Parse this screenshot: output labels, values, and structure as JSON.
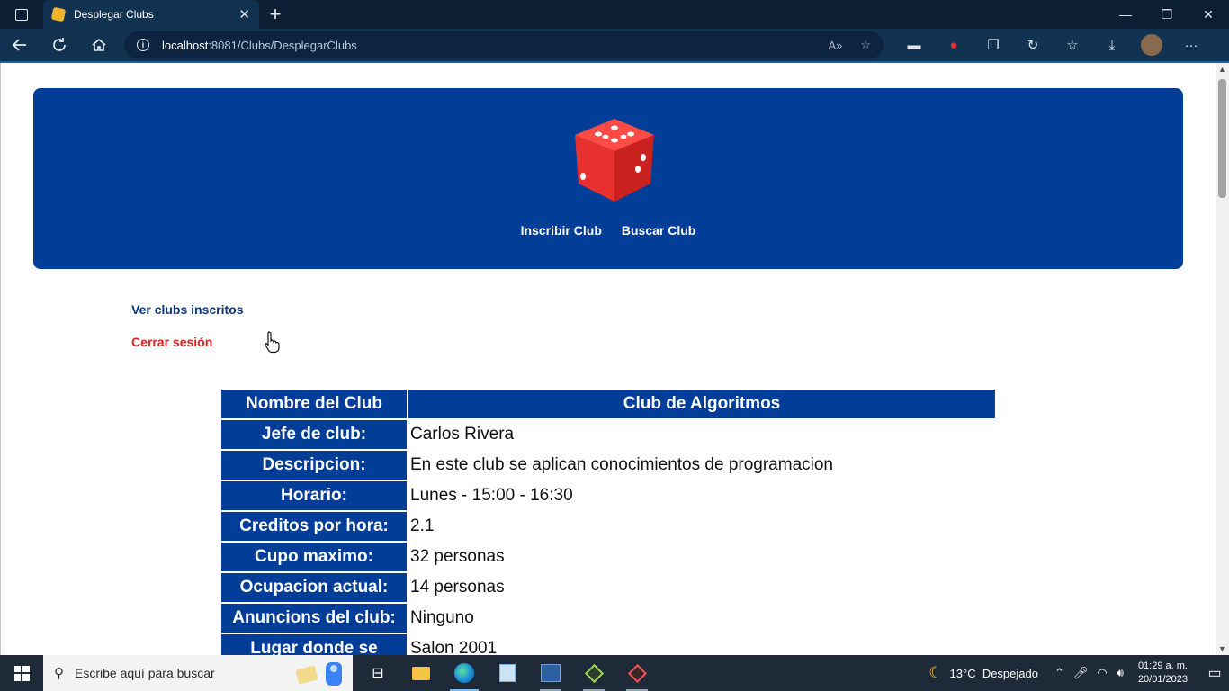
{
  "browser": {
    "tab_title": "Desplegar Clubs",
    "tab_close": "✕",
    "new_tab": "+",
    "url_host": "localhost",
    "url_path": ":8081/Clubs/DesplegarClubs",
    "window_controls": {
      "minimize": "—",
      "maximize": "❐",
      "close": "✕"
    }
  },
  "header": {
    "links": [
      "Inscribir Club",
      "Buscar Club"
    ]
  },
  "sidebar": {
    "ver_clubs": "Ver clubs inscritos",
    "cerrar_sesion": "Cerrar sesión"
  },
  "club_table": {
    "header_label": "Nombre del Club",
    "header_value": "Club de Algoritmos",
    "rows": [
      {
        "label": "Jefe de club:",
        "value": "Carlos Rivera"
      },
      {
        "label": "Descripcion:",
        "value": "En este club se aplican conocimientos de programacion"
      },
      {
        "label": "Horario:",
        "value": "Lunes - 15:00 - 16:30"
      },
      {
        "label": "Creditos por hora:",
        "value": "2.1"
      },
      {
        "label": "Cupo maximo:",
        "value": "32 personas"
      },
      {
        "label": "Ocupacion actual:",
        "value": "14 personas"
      },
      {
        "label": "Anuncions del club:",
        "value": "Ninguno"
      },
      {
        "label": "Lugar donde se",
        "value": "Salon 2001"
      }
    ]
  },
  "taskbar": {
    "search_placeholder": "Escribe aquí para buscar",
    "weather_temp": "13°C",
    "weather_text": "Despejado",
    "time": "01:29 a. m.",
    "date": "20/01/2023"
  },
  "colors": {
    "primary_blue": "#023d98",
    "logout_red": "#e02020",
    "link_blue": "#0a3a7d",
    "dice_red": "#e8312f"
  }
}
